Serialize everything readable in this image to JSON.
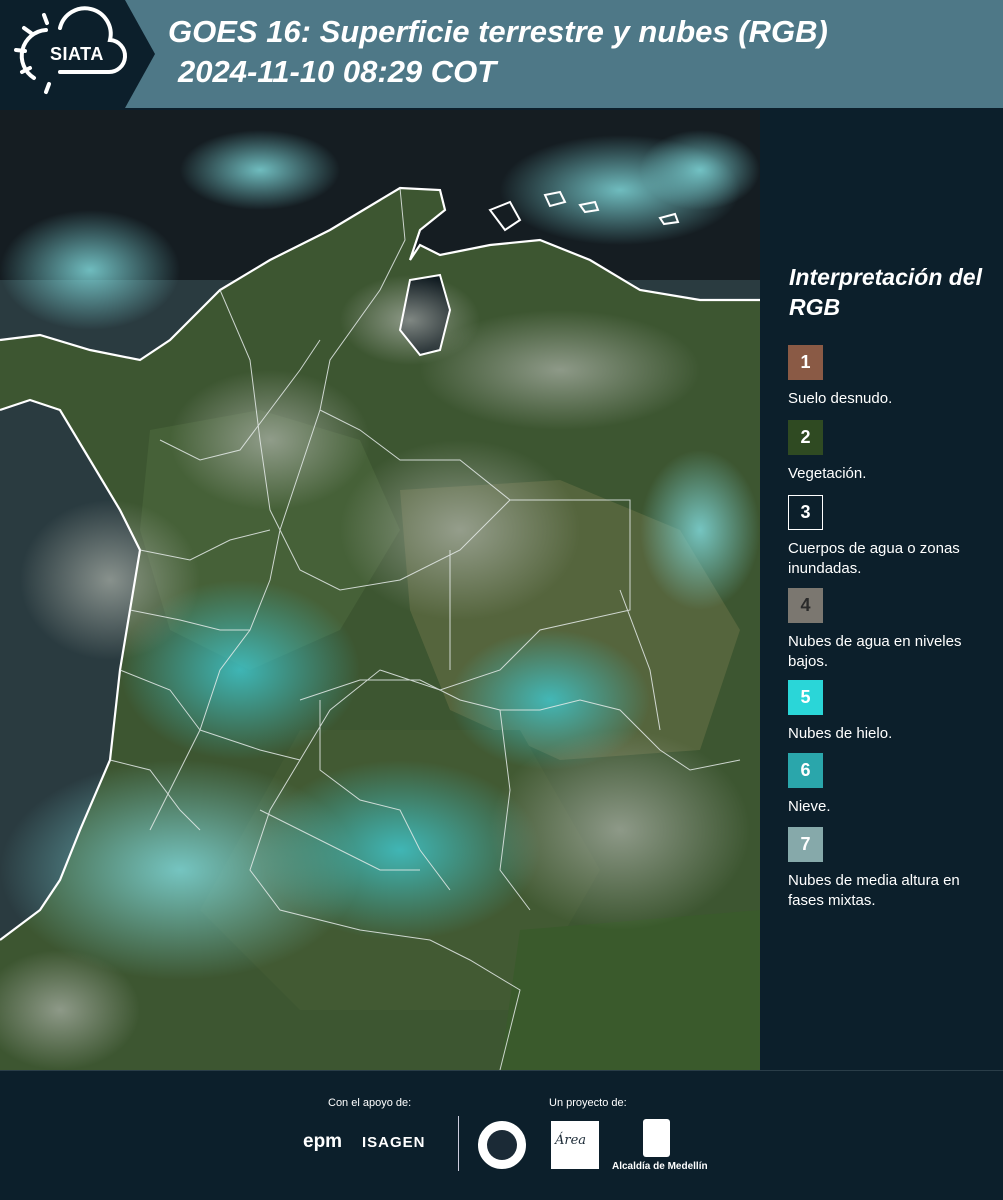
{
  "header": {
    "logo_text": "SIATA",
    "title_line1": "GOES 16: Superficie terrestre y nubes (RGB)",
    "title_line2": "2024-11-10 08:29 COT"
  },
  "map": {
    "description_icon": "satellite-map"
  },
  "legend": {
    "title": "Interpretación del RGB",
    "items": [
      {
        "number": "1",
        "label": "Suelo desnudo.",
        "color": "#8a5a45"
      },
      {
        "number": "2",
        "label": "Vegetación.",
        "color": "#2f4a22"
      },
      {
        "number": "3",
        "label": "Cuerpos de agua o zonas inundadas.",
        "color": "#0c1f2b"
      },
      {
        "number": "4",
        "label": "Nubes de agua en niveles bajos.",
        "color": "#7b7770"
      },
      {
        "number": "5",
        "label": "Nubes de hielo.",
        "color": "#2ad6d8"
      },
      {
        "number": "6",
        "label": "Nieve.",
        "color": "#2aa6ab"
      },
      {
        "number": "7",
        "label": "Nubes de media altura en fases mixtas.",
        "color": "#86a9aa"
      }
    ]
  },
  "footer": {
    "support_label": "Con el apoyo de:",
    "project_label": "Un proyecto de:",
    "epm": "epm",
    "isagen": "ISAGEN",
    "area_text": "Área",
    "alcaldia": "Alcaldía de Medellín"
  }
}
